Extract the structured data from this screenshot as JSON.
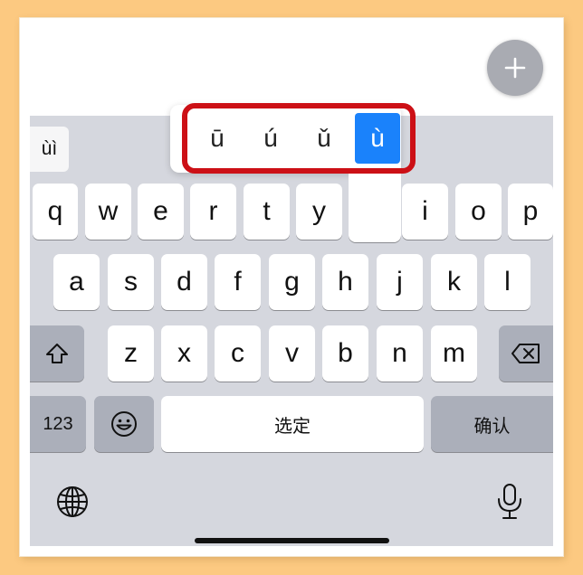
{
  "colors": {
    "selected": "#1A82FB",
    "highlight_border": "#CC1016",
    "fab": "#A9ABB2",
    "key_bg": "#FFFFFF",
    "function_key_bg": "#ABAFBA",
    "keyboard_bg": "#D5D7DE"
  },
  "app": {
    "fab_icon": "plus-icon"
  },
  "candidate_bar": {
    "left_candidate": "ùì"
  },
  "popup": {
    "options": [
      "ū",
      "ú",
      "ǔ",
      "ù"
    ],
    "selected_index": 3
  },
  "keyboard": {
    "row1": [
      "q",
      "w",
      "e",
      "r",
      "t",
      "y",
      "",
      "i",
      "o",
      "p"
    ],
    "row2": [
      "a",
      "s",
      "d",
      "f",
      "g",
      "h",
      "j",
      "k",
      "l"
    ],
    "row3": [
      "z",
      "x",
      "c",
      "v",
      "b",
      "n",
      "m"
    ],
    "shift_icon": "shift-icon",
    "delete_icon": "backspace-icon",
    "numbers_label": "123",
    "emoji_icon": "emoji-icon",
    "space_label": "选定",
    "return_label": "确认",
    "globe_icon": "globe-icon",
    "mic_icon": "microphone-icon"
  }
}
